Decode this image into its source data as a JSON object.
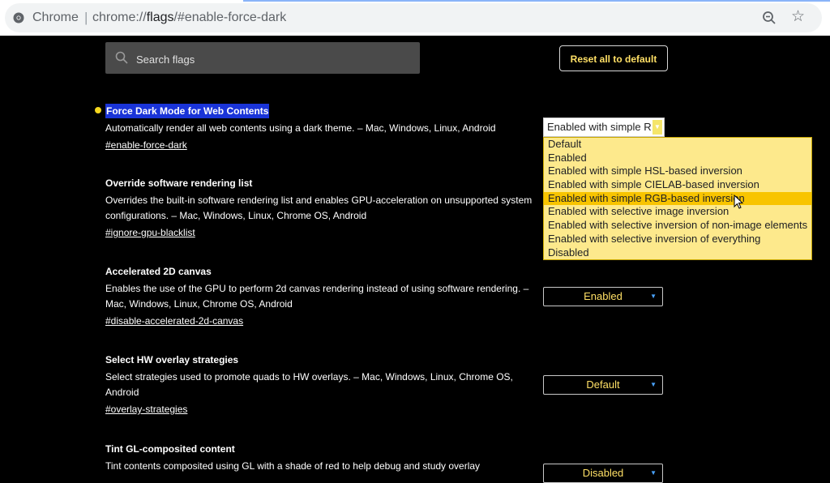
{
  "browser": {
    "label": "Chrome",
    "url_prefix": "chrome://",
    "url_host": "flags",
    "url_rest": "/#enable-force-dark"
  },
  "toolbar": {
    "search_placeholder": "Search flags",
    "reset_label": "Reset all to default"
  },
  "experiments": [
    {
      "title": "Force Dark Mode for Web Contents",
      "description": "Automatically render all web contents using a dark theme. – Mac, Windows, Linux, Android",
      "link": "#enable-force-dark",
      "value": "Enabled with simple R"
    },
    {
      "title": "Override software rendering list",
      "description": "Overrides the built-in software rendering list and enables GPU-acceleration on unsupported system configurations. – Mac, Windows, Linux, Chrome OS, Android",
      "link": "#ignore-gpu-blacklist"
    },
    {
      "title": "Accelerated 2D canvas",
      "description": "Enables the use of the GPU to perform 2d canvas rendering instead of using software rendering. – Mac, Windows, Linux, Chrome OS, Android",
      "link": "#disable-accelerated-2d-canvas",
      "value": "Enabled"
    },
    {
      "title": "Select HW overlay strategies",
      "description": "Select strategies used to promote quads to HW overlays. – Mac, Windows, Linux, Chrome OS, Android",
      "link": "#overlay-strategies",
      "value": "Default"
    },
    {
      "title": "Tint GL-composited content",
      "description": "Tint contents composited using GL with a shade of red to help debug and study overlay",
      "value": "Disabled"
    }
  ],
  "dropdown_options": [
    "Default",
    "Enabled",
    "Enabled with simple HSL-based inversion",
    "Enabled with simple CIELAB-based inversion",
    "Enabled with simple RGB-based inversion",
    "Enabled with selective image inversion",
    "Enabled with selective inversion of non-image elements",
    "Enabled with selective inversion of everything",
    "Disabled"
  ],
  "colors": {
    "accent_yellow": "#ffe066",
    "highlight_blue": "#1a34d8",
    "menu_bg": "#fde98c",
    "menu_active": "#f8c400"
  }
}
